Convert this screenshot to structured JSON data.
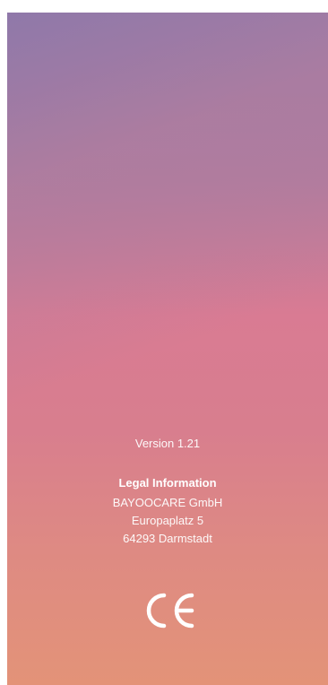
{
  "about": {
    "version": "Version 1.21",
    "legal_title": "Legal Information",
    "company": "BAYOOCARE GmbH",
    "street": "Europaplatz 5",
    "city": "64293 Darmstadt",
    "mark_icon": "ce-mark-icon"
  },
  "colors": {
    "top": "#a27ba6",
    "middle": "#d97b93",
    "bottom": "#e39378",
    "text": "#ffffff"
  }
}
